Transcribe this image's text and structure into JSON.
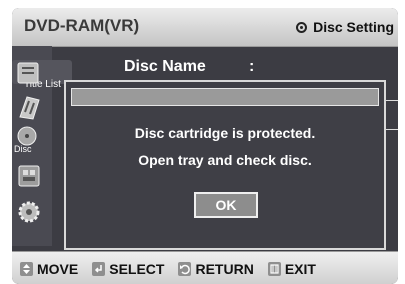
{
  "header": {
    "mode_title": "DVD-RAM(VR)",
    "setting_label": "Disc Setting",
    "setting_icon": "disc-icon"
  },
  "sidebar": {
    "active_tab_label": "Title List",
    "items": [
      {
        "label": "",
        "icon": "title-list-icon"
      },
      {
        "label": "",
        "icon": "playlist-icon"
      },
      {
        "label": "Disc",
        "icon": "disc-manager-icon"
      },
      {
        "label": "",
        "icon": "timer-icon"
      },
      {
        "label": "",
        "icon": "setup-gear-icon"
      }
    ]
  },
  "main": {
    "heading": "Disc Name",
    "colon": ":"
  },
  "dialog": {
    "message_line1": "Disc cartridge is protected.",
    "message_line2": "Open tray and check disc.",
    "ok_label": "OK"
  },
  "footer": {
    "items": [
      {
        "icon": "updown-arrows-icon",
        "label": "MOVE"
      },
      {
        "icon": "enter-icon",
        "label": "SELECT"
      },
      {
        "icon": "return-icon",
        "label": "RETURN"
      },
      {
        "icon": "menu-icon",
        "label": "EXIT"
      }
    ]
  },
  "colors": {
    "panel_bg": "#3c3c43",
    "dialog_bg": "#3f3f46",
    "button_bg": "#8d8d8d"
  }
}
